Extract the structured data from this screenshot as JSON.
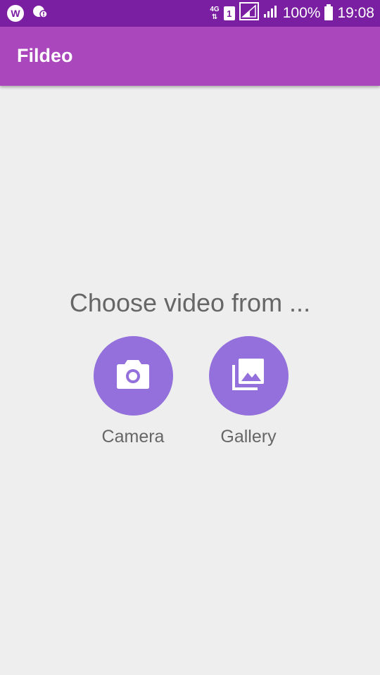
{
  "status_bar": {
    "network": "4G",
    "sim": "1",
    "battery": "100%",
    "time": "19:08",
    "icons": [
      "w-app-icon",
      "notification-icon",
      "network-4g-icon",
      "sim-icon",
      "signal-icon",
      "signal-icon",
      "battery-icon"
    ]
  },
  "app_bar": {
    "title": "Fildeo"
  },
  "main": {
    "prompt": "Choose video from ...",
    "options": [
      {
        "label": "Camera",
        "icon": "camera-icon"
      },
      {
        "label": "Gallery",
        "icon": "gallery-icon"
      }
    ]
  },
  "colors": {
    "status_bar": "#7b1fa2",
    "app_bar": "#ab47bc",
    "background": "#eeeeee",
    "button": "#9370db",
    "text": "#666666"
  }
}
